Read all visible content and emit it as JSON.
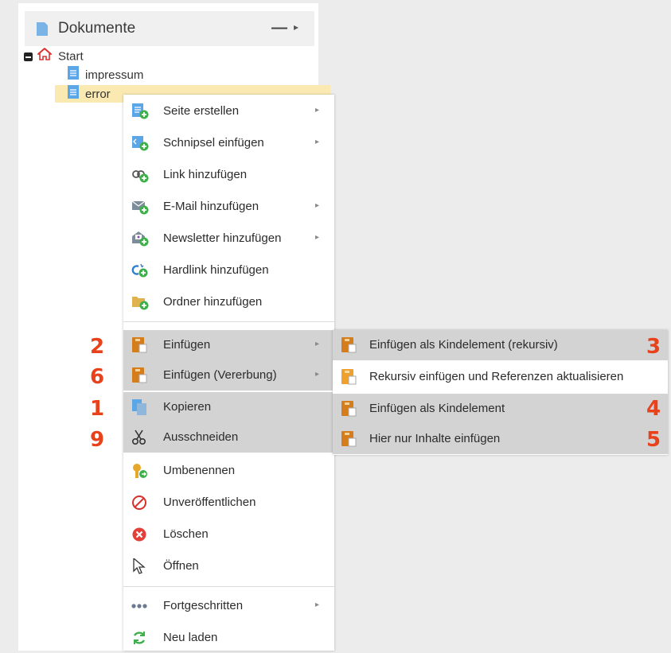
{
  "panel": {
    "title": "Dokumente",
    "minimize_symbol": "—",
    "expand_symbol": "▸"
  },
  "tree": {
    "items": [
      {
        "label": "Start",
        "icon": "house-icon"
      },
      {
        "label": "impressum",
        "icon": "document-icon"
      },
      {
        "label": "error",
        "icon": "document-icon"
      }
    ]
  },
  "context_menu": {
    "items": [
      {
        "label": "Seite erstellen",
        "icon": "page-add-icon",
        "submenu": true
      },
      {
        "label": "Schnipsel einfügen",
        "icon": "snippet-add-icon",
        "submenu": true
      },
      {
        "label": "Link hinzufügen",
        "icon": "link-add-icon",
        "submenu": false
      },
      {
        "label": "E-Mail hinzufügen",
        "icon": "email-add-icon",
        "submenu": true
      },
      {
        "label": "Newsletter hinzufügen",
        "icon": "newsletter-add-icon",
        "submenu": true
      },
      {
        "label": "Hardlink hinzufügen",
        "icon": "hardlink-add-icon",
        "submenu": false
      },
      {
        "label": "Ordner hinzufügen",
        "icon": "folder-add-icon",
        "submenu": false
      },
      {
        "label": "Einfügen",
        "icon": "paste-icon",
        "submenu": true
      },
      {
        "label": "Einfügen (Vererbung)",
        "icon": "paste-inherit-icon",
        "submenu": true
      },
      {
        "label": "Kopieren",
        "icon": "copy-icon",
        "submenu": false
      },
      {
        "label": "Ausschneiden",
        "icon": "scissors-icon",
        "submenu": false
      },
      {
        "label": "Umbenennen",
        "icon": "rename-icon",
        "submenu": false
      },
      {
        "label": "Unveröffentlichen",
        "icon": "unpublish-icon",
        "submenu": false
      },
      {
        "label": "Löschen",
        "icon": "delete-icon",
        "submenu": false
      },
      {
        "label": "Öffnen",
        "icon": "cursor-icon",
        "submenu": false
      },
      {
        "label": "Fortgeschritten",
        "icon": "more-icon",
        "submenu": true
      },
      {
        "label": "Neu laden",
        "icon": "reload-icon",
        "submenu": false
      }
    ]
  },
  "paste_submenu": {
    "items": [
      {
        "label": "Einfügen als Kindelement (rekursiv)",
        "icon": "paste-icon"
      },
      {
        "label": "Rekursiv einfügen und Referenzen aktualisieren",
        "icon": "paste-icon"
      },
      {
        "label": "Einfügen als Kindelement",
        "icon": "paste-icon"
      },
      {
        "label": "Hier nur Inhalte einfügen",
        "icon": "paste-icon"
      }
    ]
  },
  "annotations": {
    "paste": "2",
    "paste_inherit": "6",
    "copy": "1",
    "cut": "9",
    "child_recursive": "3",
    "child": "4",
    "contents_only": "5"
  },
  "colors": {
    "annotation": "#e8421d",
    "selected_row": "#faeab2",
    "highlight": "#d3d3d3",
    "doc_blue": "#5aa6e6",
    "add_green": "#3db04a",
    "paste_orange": "#d67d1b"
  },
  "submenu_arrow": "▸"
}
